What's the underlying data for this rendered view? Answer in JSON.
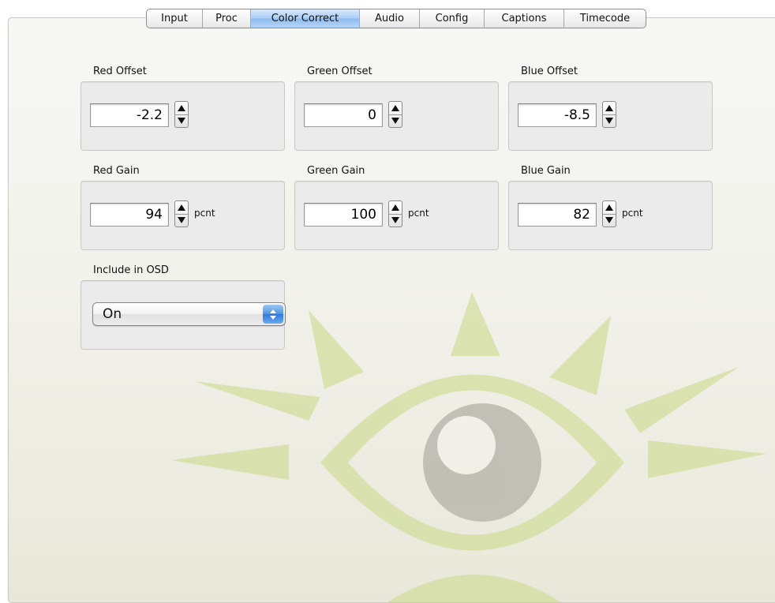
{
  "tabs": [
    {
      "label": "Input",
      "active": false
    },
    {
      "label": "Proc",
      "active": false
    },
    {
      "label": "Color Correct",
      "active": true
    },
    {
      "label": "Audio",
      "active": false
    },
    {
      "label": "Config",
      "active": false
    },
    {
      "label": "Captions",
      "active": false
    },
    {
      "label": "Timecode",
      "active": false
    }
  ],
  "offsets": {
    "red": {
      "label": "Red Offset",
      "value": "-2.2"
    },
    "green": {
      "label": "Green Offset",
      "value": "0"
    },
    "blue": {
      "label": "Blue Offset",
      "value": "-8.5"
    }
  },
  "gains": {
    "unit": "pcnt",
    "red": {
      "label": "Red Gain",
      "value": "94"
    },
    "green": {
      "label": "Green Gain",
      "value": "100"
    },
    "blue": {
      "label": "Blue Gain",
      "value": "82"
    }
  },
  "osd": {
    "label": "Include in OSD",
    "selected": "On"
  },
  "icons": {
    "stepper_up": "triangle-up-icon",
    "stepper_down": "triangle-down-icon",
    "select_arrows": "updown-chevron-icon",
    "watermark": "eye-logo"
  },
  "colors": {
    "active_tab": "#a9cdf6",
    "watermark_green": "#d3df9e",
    "watermark_gray": "#b2b1a8"
  }
}
